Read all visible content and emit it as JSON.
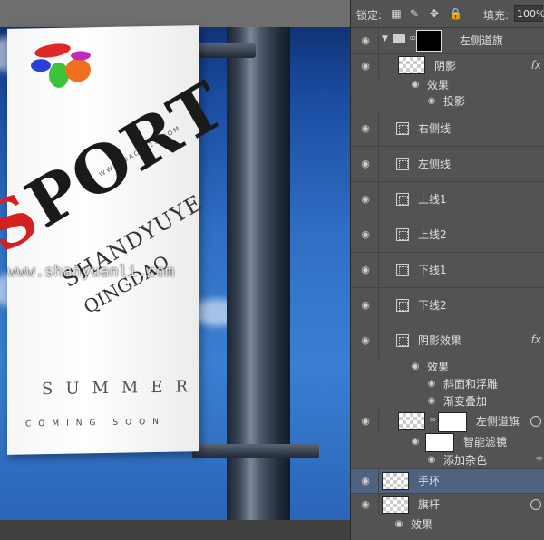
{
  "canvas": {
    "watermark": "www.shanyuanli.com",
    "banner": {
      "site_url": "WWW.DAOQI23.COM",
      "sport_first": "S",
      "sport_rest": "PORT",
      "line2": "SHANDYUYE",
      "line3": "QINGDAO",
      "summer": "SUMMER",
      "coming_soon": "COMING SOON"
    }
  },
  "toolbar": {
    "lock_label": "锁定:",
    "lock_icons": [
      "lock-transparent-pixels-icon",
      "lock-image-pixels-icon",
      "lock-position-icon",
      "lock-all-icon"
    ],
    "fill_label": "填充:",
    "fill_value": "100%"
  },
  "layers": [
    {
      "type": "group",
      "name": "左侧道旗",
      "eye": true
    },
    {
      "type": "layer",
      "name": "阴影",
      "fx": "fx",
      "eye": true
    },
    {
      "type": "effects",
      "name": "效果"
    },
    {
      "type": "effect",
      "name": "投影"
    },
    {
      "type": "shape",
      "name": "右侧线",
      "eye": true
    },
    {
      "type": "shape",
      "name": "左侧线",
      "eye": true
    },
    {
      "type": "shape",
      "name": "上线1",
      "eye": true
    },
    {
      "type": "shape",
      "name": "上线2",
      "eye": true
    },
    {
      "type": "shape",
      "name": "下线1",
      "eye": true
    },
    {
      "type": "shape",
      "name": "下线2",
      "eye": true
    },
    {
      "type": "shape",
      "name": "阴影效果",
      "fx": "fx",
      "eye": true
    },
    {
      "type": "effects",
      "name": "效果"
    },
    {
      "type": "effect",
      "name": "斜面和浮雕"
    },
    {
      "type": "effect",
      "name": "渐变叠加"
    },
    {
      "type": "smart",
      "name": "左侧道旗",
      "eye": true
    },
    {
      "type": "smartfilter",
      "name": "智能滤镜"
    },
    {
      "type": "effect",
      "name": "添加杂色"
    },
    {
      "type": "layer",
      "name": "手环",
      "eye": true,
      "selected": true
    },
    {
      "type": "layer",
      "name": "旗杆",
      "eye": true
    },
    {
      "type": "effects",
      "name": "效果"
    }
  ]
}
